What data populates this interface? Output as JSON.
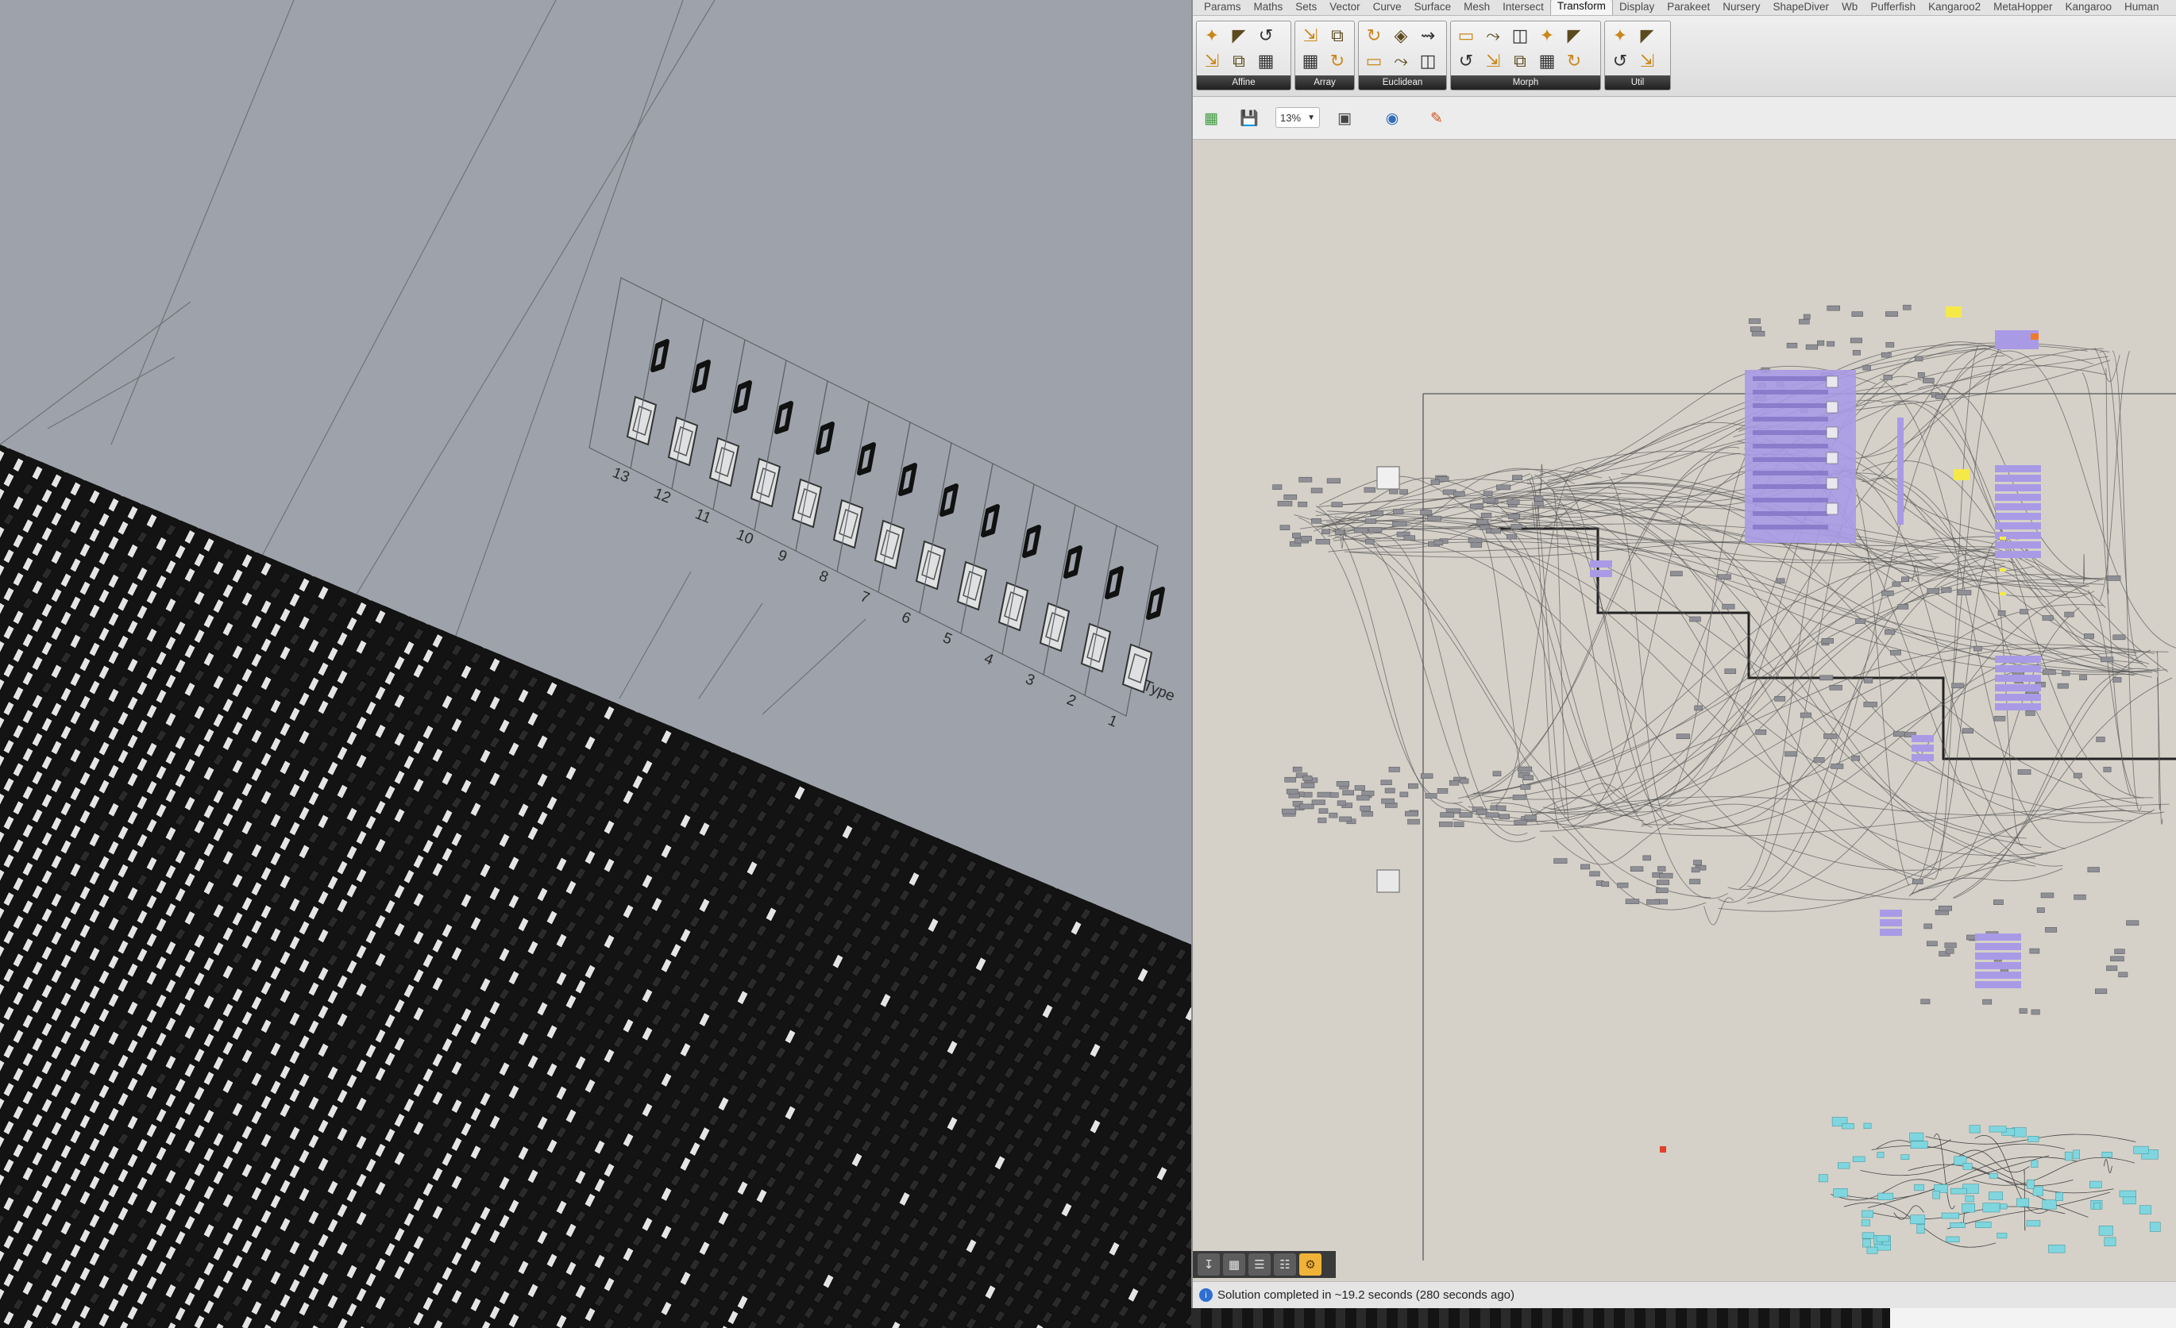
{
  "viewport": {
    "type_labels": [
      "13",
      "12",
      "11",
      "10",
      "9",
      "8",
      "7",
      "6",
      "5",
      "4",
      "3",
      "2",
      "1"
    ],
    "type_caption": "Type"
  },
  "gh": {
    "tabs": [
      "Params",
      "Maths",
      "Sets",
      "Vector",
      "Curve",
      "Surface",
      "Mesh",
      "Intersect",
      "Transform",
      "Display",
      "Parakeet",
      "Nursery",
      "ShapeDiver",
      "Wb",
      "Pufferfish",
      "Kangaroo2",
      "MetaHopper",
      "Kangaroo",
      "Human"
    ],
    "active_tab": "Transform",
    "panels": [
      {
        "label": "Affine",
        "icons": [
          "scale-icon",
          "shear-icon",
          "orient-icon",
          "project-icon",
          "mirror-icon",
          "box-map-icon"
        ]
      },
      {
        "label": "Array",
        "icons": [
          "curve-array-icon",
          "polar-array-icon",
          "linear-array-icon",
          "grid-array-icon"
        ]
      },
      {
        "label": "Euclidean",
        "icons": [
          "move-icon",
          "rotate-icon",
          "orient-direction-icon",
          "move-to-plane-icon",
          "rotate-axis-icon",
          "rotate-direction-icon"
        ]
      },
      {
        "label": "Morph",
        "icons": [
          "bend-icon",
          "twist-icon",
          "flow-icon",
          "stretch-icon",
          "taper-icon",
          "splop-icon",
          "sporph-icon",
          "surface-box-icon",
          "box-morph-icon",
          "blend-box-icon"
        ]
      },
      {
        "label": "Util",
        "icons": [
          "compound-icon",
          "split-icon",
          "inverse-icon",
          "transform-icon"
        ]
      }
    ],
    "toolbar": {
      "zoom": "13%"
    },
    "status": "Solution completed in ~19.2 seconds (280 seconds ago)",
    "colors": {
      "canvas": "#d5d1c9",
      "cluster_purple": "#a99ae6",
      "cluster_cyan": "#7fd6de",
      "component_grey": "#8f8f96",
      "wire": "#555555"
    }
  }
}
